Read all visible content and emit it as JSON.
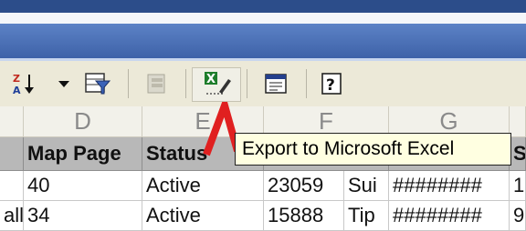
{
  "toolbar": {
    "items": [
      {
        "name": "sort-descending-icon",
        "glyph": "Z↓"
      },
      {
        "name": "dropdown-arrow-icon",
        "glyph": "▾"
      },
      {
        "name": "filter-icon",
        "glyph": "▽"
      },
      {
        "name": "disabled-tool-icon",
        "glyph": "▤"
      },
      {
        "name": "export-excel-icon",
        "glyph": "X"
      },
      {
        "name": "report-icon",
        "glyph": "▦"
      },
      {
        "name": "help-icon",
        "glyph": "?"
      }
    ]
  },
  "column_letters": [
    "D",
    "E",
    "F",
    "G"
  ],
  "field_headers": [
    "Map Page",
    "Status",
    "",
    "",
    "S"
  ],
  "rows": [
    [
      "",
      "40",
      "Active",
      "23059",
      "Sui",
      "########",
      "1"
    ],
    [
      "all",
      "34",
      "Active",
      "15888",
      "Tip",
      "########",
      "9"
    ]
  ],
  "tooltip": "Export to Microsoft Excel",
  "colors": {
    "arrow": "#e02020",
    "excel_green": "#1e7d2b"
  }
}
